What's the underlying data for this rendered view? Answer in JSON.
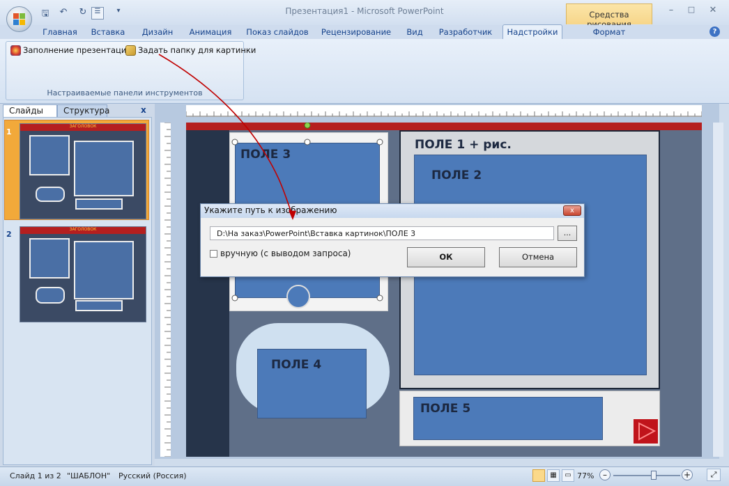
{
  "window": {
    "title": "Презентация1 - Microsoft PowerPoint",
    "context_tab": "Средства рисования",
    "help_glyph": "?"
  },
  "ribbon": {
    "tabs": [
      "Главная",
      "Вставка",
      "Дизайн",
      "Анимация",
      "Показ слайдов",
      "Рецензирование",
      "Вид",
      "Разработчик",
      "Надстройки",
      "Формат"
    ],
    "active_tab": "Надстройки",
    "buttons": {
      "fill": "Заполнение презентации",
      "set_folder": "Задать папку для картинки"
    },
    "group_label": "Настраиваемые панели инструментов"
  },
  "panel": {
    "tab_slides": "Слайды",
    "tab_outline": "Структура",
    "close": "x",
    "slide_numbers": [
      "1",
      "2"
    ],
    "thumb_title": "ЗАГОЛОВОК"
  },
  "slide": {
    "fields": [
      "ПОЛЕ 1 + рис.",
      "ПОЛЕ 2",
      "ПОЛЕ 3",
      "ПОЛЕ 4",
      "ПОЛЕ 5"
    ]
  },
  "dialog": {
    "title": "Укажите путь к изображению",
    "path": "D:\\На заказ\\PowerPoint\\Вставка картинок\\ПОЛЕ 3",
    "browse": "...",
    "checkbox_label": "вручную (с выводом запроса)",
    "ok": "ОК",
    "cancel": "Отмена",
    "close_glyph": "x"
  },
  "status": {
    "slide_info": "Слайд 1 из 2",
    "theme": "\"ШАБЛОН\"",
    "language": "Русский (Россия)",
    "zoom": "77%",
    "zoom_level": 0.77
  },
  "colors": {
    "accent_tab": "#f7d68a",
    "slide_red": "#b51f1f",
    "box_blue": "#4c7ab9",
    "arrow": "#c00000"
  }
}
